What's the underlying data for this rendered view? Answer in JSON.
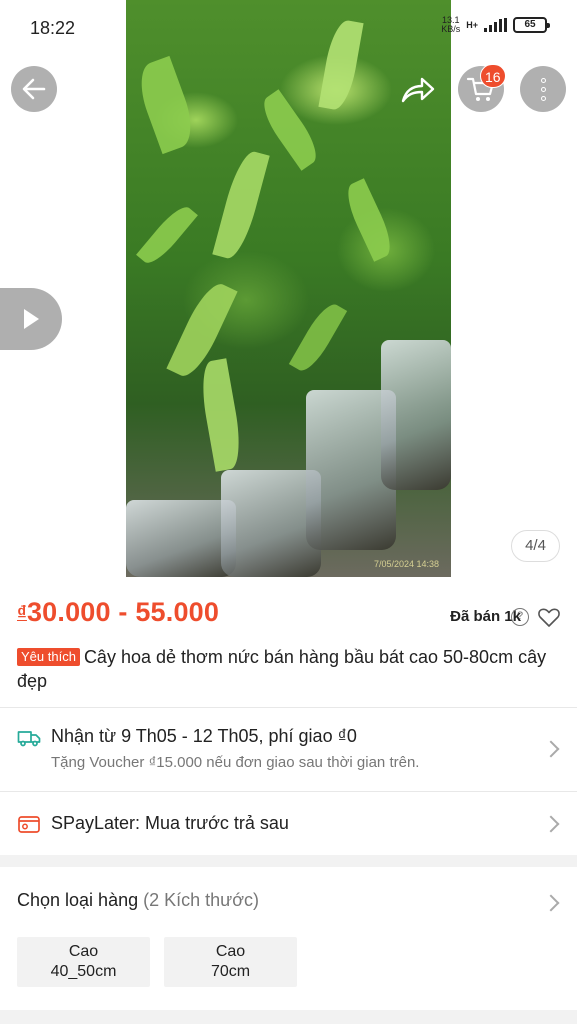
{
  "status_bar": {
    "time": "18:22",
    "net_speed_value": "13.1",
    "net_speed_unit": "KB/s",
    "net_type": "H+",
    "battery": "65"
  },
  "gallery": {
    "counter": "4/4",
    "photo_stamp": "7/05/2024 14:38",
    "cart_count": "16"
  },
  "product": {
    "price_currency": "₫",
    "price_range": "30.000 - 55.000",
    "sold_label": "Đã bán 1k",
    "fav_badge": "Yêu thích",
    "title": "Cây hoa dẻ thơm nức bán hàng bầu bát cao 50-80cm cây đẹp"
  },
  "shipping": {
    "main": "Nhận từ 9 Th05 - 12 Th05, phí giao ₫0",
    "sub": "Tặng Voucher ₫15.000 nếu đơn giao sau thời gian trên."
  },
  "spaylater": {
    "label": "SPayLater: Mua trước trả sau"
  },
  "variants": {
    "title": "Chọn loại hàng",
    "count": "(2 Kích thước)",
    "options": [
      {
        "line1": "Cao",
        "line2": "40_50cm"
      },
      {
        "line1": "Cao",
        "line2": "70cm"
      }
    ]
  },
  "colors": {
    "accent": "#ee4d2d",
    "shipping_icon": "#26aa99"
  }
}
